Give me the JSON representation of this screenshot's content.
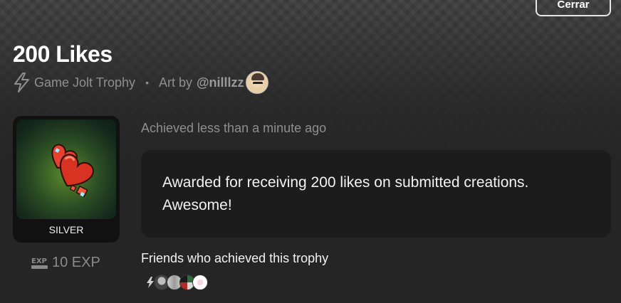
{
  "header": {
    "close_label": "Cerrar"
  },
  "trophy": {
    "title": "200 Likes",
    "source": "Game Jolt Trophy",
    "separator": "•",
    "art_by_label": "Art by",
    "artist_handle": "@nilllzz",
    "tier": "SILVER",
    "exp": "10 EXP",
    "exp_icon_text": "EXP",
    "achieved_text": "Achieved less than a minute ago",
    "description": "Awarded for receiving 200 likes on submitted creations. Awesome!"
  },
  "friends": {
    "label": "Friends who achieved this trophy",
    "avatars": [
      "friend-avatar-1",
      "friend-avatar-2",
      "friend-avatar-3",
      "friend-avatar-4"
    ]
  },
  "icons": {
    "bolt": "bolt-icon",
    "exp": "exp-icon",
    "trophy_art": "hearts-icon"
  },
  "colors": {
    "background": "#2a2a2a",
    "panel": "#1c1c1c",
    "muted_text": "#8f8f8f",
    "heart_red": "#e23c2a",
    "trophy_glow": "#5b8a2c"
  }
}
